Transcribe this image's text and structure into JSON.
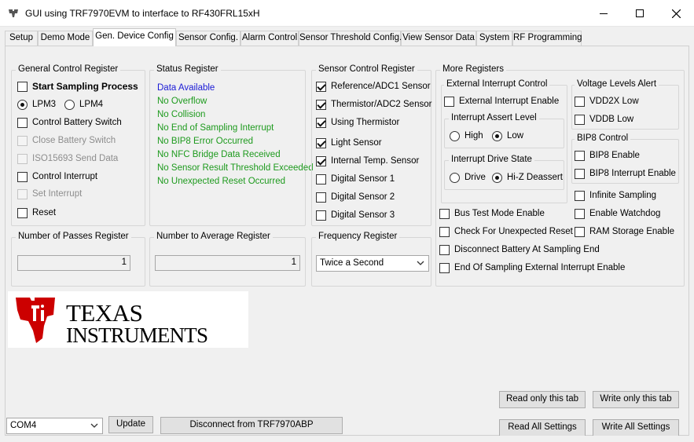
{
  "window": {
    "title": "GUI using TRF7970EVM to interface to RF430FRL15xH",
    "icon": "ti-logo-icon",
    "controls": [
      "minimize-icon",
      "maximize-icon",
      "close-icon"
    ]
  },
  "tabs": [
    {
      "label": "Setup"
    },
    {
      "label": "Demo Mode"
    },
    {
      "label": "Gen. Device Config"
    },
    {
      "label": "Sensor Config."
    },
    {
      "label": "Alarm Control"
    },
    {
      "label": "Sensor Threshold Config."
    },
    {
      "label": "View Sensor Data"
    },
    {
      "label": "System"
    },
    {
      "label": "RF Programming"
    }
  ],
  "active_tab": "Gen. Device Config",
  "general_control": {
    "title": "General Control Register",
    "start_sampling": "Start Sampling Process",
    "lpm3": "LPM3",
    "lpm4": "LPM4",
    "control_battery_switch": "Control Battery Switch",
    "close_battery_switch": "Close Battery Switch",
    "iso15693_send_data": "ISO15693 Send Data",
    "control_interrupt": "Control Interrupt",
    "set_interrupt": "Set Interrupt",
    "reset": "Reset"
  },
  "status_register": {
    "title": "Status Register",
    "items": [
      "Data Available",
      "No Overflow",
      "No Collision",
      "No End of Sampling Interrupt",
      "No BIP8 Error Occurred",
      "No NFC Bridge Data Received",
      "No Sensor Result Threshold Exceeded",
      "No Unexpected Reset Occurred"
    ]
  },
  "sensor_control": {
    "title": "Sensor Control Register",
    "reference_adc1": "Reference/ADC1 Sensor",
    "thermistor_adc2": "Thermistor/ADC2 Sensor",
    "using_thermistor": "Using Thermistor",
    "light_sensor": "Light Sensor",
    "internal_temp": "Internal Temp. Sensor",
    "digital_1": "Digital Sensor 1",
    "digital_2": "Digital Sensor 2",
    "digital_3": "Digital Sensor 3"
  },
  "more_registers": {
    "title": "More Registers",
    "ext_int_control": {
      "title": "External Interrupt Control",
      "enable": "External Interrupt Enable",
      "assert_level": {
        "title": "Interrupt Assert Level",
        "high": "High",
        "low": "Low"
      },
      "drive_state": {
        "title": "Interrupt Drive State",
        "drive": "Drive",
        "hiz": "Hi-Z Deassert"
      }
    },
    "voltage_alert": {
      "title": "Voltage Levels Alert",
      "vdd2x": "VDD2X Low",
      "vddb": "VDDB Low"
    },
    "bip8": {
      "title": "BIP8 Control",
      "enable": "BIP8 Enable",
      "int_enable": "BIP8 Interrupt Enable"
    },
    "infinite_sampling": "Infinite Sampling",
    "enable_watchdog": "Enable Watchdog",
    "ram_storage": "RAM Storage Enable",
    "bus_test": "Bus Test Mode Enable",
    "check_reset": "Check For Unexpected Reset",
    "disconnect_battery": "Disconnect Battery At Sampling End",
    "end_sampling_ext_int": "End Of Sampling External Interrupt Enable"
  },
  "passes": {
    "title": "Number of Passes Register",
    "value": "1"
  },
  "average": {
    "title": "Number to Average Register",
    "value": "1"
  },
  "frequency": {
    "title": "Frequency Register",
    "value": "Twice a Second"
  },
  "logo": {
    "line1": "TEXAS",
    "line2": "INSTRUMENTS",
    "color": "#cc0000"
  },
  "buttons": {
    "read_tab": "Read only this tab",
    "write_tab": "Write only this tab",
    "read_all": "Read All Settings",
    "write_all": "Write All Settings",
    "update": "Update",
    "disconnect": "Disconnect from TRF7970ABP"
  },
  "com_port": {
    "value": "COM4"
  }
}
